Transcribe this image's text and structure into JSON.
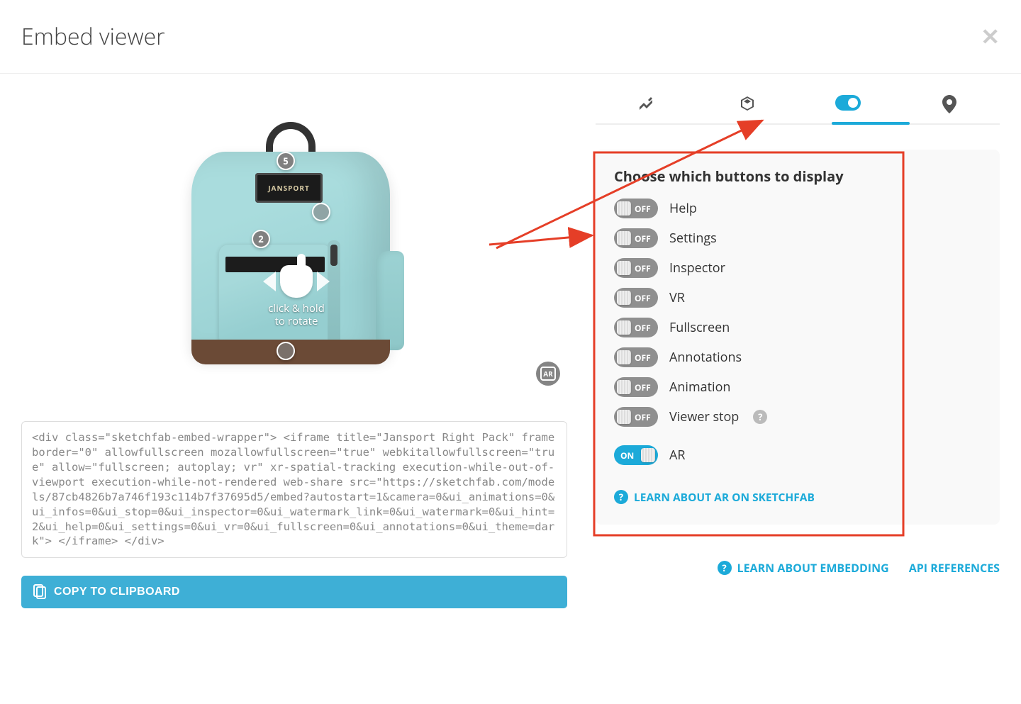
{
  "header": {
    "title": "Embed viewer",
    "close_glyph": "✕"
  },
  "viewer": {
    "hint_line1": "click & hold",
    "hint_line2": "to rotate",
    "hotspot_5": "5",
    "hotspot_2": "2",
    "ar_badge": "AR",
    "brand": "JANSPORT"
  },
  "code": "<div class=\"sketchfab-embed-wrapper\"> <iframe title=\"Jansport Right Pack\" frameborder=\"0\" allowfullscreen mozallowfullscreen=\"true\" webkitallowfullscreen=\"true\" allow=\"fullscreen; autoplay; vr\" xr-spatial-tracking execution-while-out-of-viewport execution-while-not-rendered web-share src=\"https://sketchfab.com/models/87cb4826b7a746f193c114b7f37695d5/embed?autostart=1&camera=0&ui_animations=0&ui_infos=0&ui_stop=0&ui_inspector=0&ui_watermark_link=0&ui_watermark=0&ui_hint=2&ui_help=0&ui_settings=0&ui_vr=0&ui_fullscreen=0&ui_annotations=0&ui_theme=dark\"> </iframe> </div>",
  "copy_button": "COPY TO CLIPBOARD",
  "panel": {
    "heading": "Choose which buttons to display",
    "off": "OFF",
    "on": "ON",
    "toggles": [
      {
        "label": "Help",
        "state": "off"
      },
      {
        "label": "Settings",
        "state": "off"
      },
      {
        "label": "Inspector",
        "state": "off"
      },
      {
        "label": "VR",
        "state": "off"
      },
      {
        "label": "Fullscreen",
        "state": "off"
      },
      {
        "label": "Annotations",
        "state": "off"
      },
      {
        "label": "Animation",
        "state": "off"
      },
      {
        "label": "Viewer stop",
        "state": "off",
        "help": true
      }
    ],
    "ar_row": {
      "label": "AR",
      "state": "on"
    },
    "learn_ar": "LEARN ABOUT AR ON SKETCHFAB"
  },
  "footer": {
    "learn_embedding": "LEARN ABOUT EMBEDDING",
    "api_references": "API REFERENCES"
  }
}
